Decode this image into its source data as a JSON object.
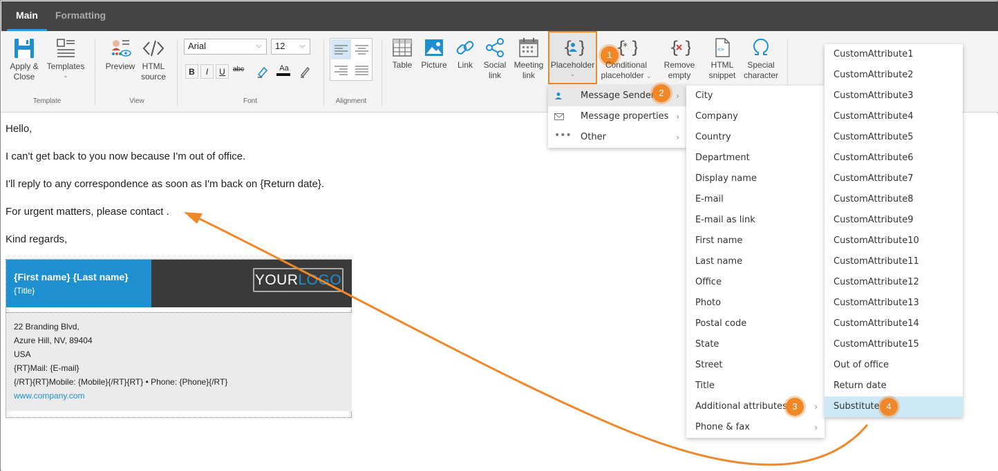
{
  "tabs": [
    {
      "label": "Main",
      "active": true
    },
    {
      "label": "Formatting",
      "active": false
    }
  ],
  "ribbon": {
    "template_group": {
      "label": "Template",
      "apply_close": [
        "Apply &",
        "Close"
      ],
      "templates": "Templates"
    },
    "view_group": {
      "label": "View",
      "preview": "Preview",
      "html_source": [
        "HTML",
        "source"
      ]
    },
    "font_group": {
      "label": "Font",
      "font_family": "Arial",
      "font_size": "12",
      "bold": "B",
      "italic": "I",
      "underline": "U",
      "strike": "abc",
      "font_color": "Aa"
    },
    "alignment_group": {
      "label": "Alignment"
    },
    "insert_group": {
      "table": "Table",
      "picture": "Picture",
      "link": "Link",
      "social_link": [
        "Social",
        "link"
      ],
      "meeting_link": [
        "Meeting",
        "link"
      ],
      "placeholder": "Placeholder",
      "conditional_placeholder": [
        "Conditional",
        "placeholder"
      ],
      "remove_empty": [
        "Remove",
        "empty"
      ],
      "html_snippet": [
        "HTML",
        "snippet"
      ],
      "special_character": [
        "Special",
        "character"
      ]
    }
  },
  "editor": {
    "lines": [
      "Hello,",
      "I can't get back to you now because I'm out of office.",
      "I'll reply to any correspondence as soon as I'm back on {Return date}.",
      "For urgent matters, please contact .",
      "Kind regards,"
    ],
    "signature": {
      "name": "{First name} {Last name}",
      "title": "{Title}",
      "logo_a": "YOUR",
      "logo_b": "LOGO",
      "address1": "22 Branding Blvd,",
      "address2": "Azure Hill, NV, 89404",
      "country": "USA",
      "mail_prefix": "{RT}Mail: ",
      "mail_value": "{E-mail}",
      "mobile_line_a": "{/RT}{RT}Mobile: ",
      "mobile_value": "{Mobile}",
      "mobile_line_b": "{/RT}{RT} • Phone: ",
      "phone_value": "{Phone}",
      "mobile_line_c": "{/RT}",
      "website": "www.company.com"
    }
  },
  "menu_level1": [
    {
      "label": "Message Sender",
      "icon": "person-icon"
    },
    {
      "label": "Message properties",
      "icon": "envelope-icon"
    },
    {
      "label": "Other",
      "icon": "ellipsis-icon"
    }
  ],
  "menu_level2": [
    "City",
    "Company",
    "Country",
    "Department",
    "Display name",
    "E-mail",
    "E-mail as link",
    "First name",
    "Last name",
    "Office",
    "Photo",
    "Postal code",
    "State",
    "Street",
    "Title",
    "Additional attributes",
    "Phone & fax"
  ],
  "menu_level3": [
    "CustomAttribute1",
    "CustomAttribute2",
    "CustomAttribute3",
    "CustomAttribute4",
    "CustomAttribute5",
    "CustomAttribute6",
    "CustomAttribute7",
    "CustomAttribute8",
    "CustomAttribute9",
    "CustomAttribute10",
    "CustomAttribute11",
    "CustomAttribute12",
    "CustomAttribute13",
    "CustomAttribute14",
    "CustomAttribute15",
    "Out of office",
    "Return date",
    "Substitute"
  ],
  "badges": [
    "1",
    "2",
    "3",
    "4"
  ],
  "colors": {
    "accent_orange": "#f0882a",
    "tab_bar": "#444444",
    "signature_blue": "#1e90d0",
    "menu_highlight": "#cde8f6"
  }
}
